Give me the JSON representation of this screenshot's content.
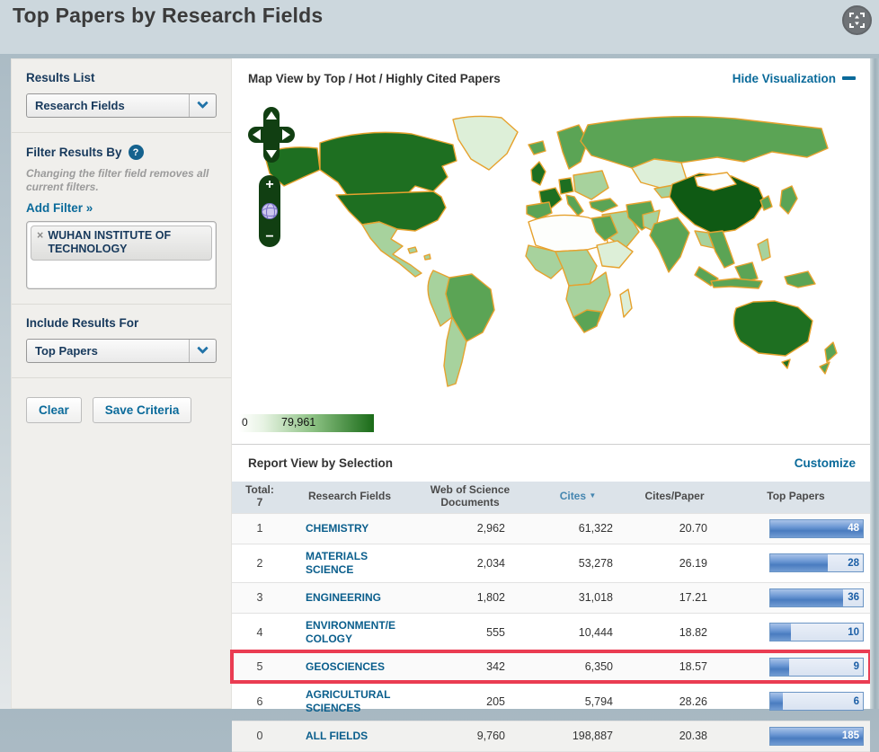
{
  "page": {
    "title": "Top Papers by Research Fields"
  },
  "colors": {
    "accent_blue": "#0a6a9a",
    "navy_heading": "#17395c",
    "map_border_orange": "#e6a22e",
    "map_scale_low": "#ffffff",
    "map_scale_high": "#1a6b18",
    "bar_blue": "#4a7cc0",
    "highlight_red": "#ea3c52",
    "header_bg": "#ccd7dd"
  },
  "sidebar": {
    "results_list": {
      "label": "Results List",
      "value": "Research Fields"
    },
    "filter": {
      "label": "Filter Results By",
      "help": "?",
      "note": "Changing the filter field removes all current filters.",
      "add_filter": "Add Filter »",
      "chip": {
        "remove": "×",
        "label": "WUHAN INSTITUTE OF TECHNOLOGY"
      }
    },
    "include": {
      "label": "Include Results For",
      "value": "Top Papers"
    },
    "buttons": {
      "clear": "Clear",
      "save": "Save Criteria"
    }
  },
  "map": {
    "title": "Map View by Top / Hot / Highly Cited Papers",
    "hide_link": "Hide Visualization",
    "legend": {
      "min": "0",
      "max": "79,961"
    },
    "controls": {
      "zoom_in": "+",
      "zoom_out": "−"
    }
  },
  "report": {
    "title": "Report View by Selection",
    "customize": "Customize",
    "table": {
      "headers": {
        "total_line1": "Total:",
        "total_line2": "7",
        "field": "Research Fields",
        "documents": "Web of Science Documents",
        "cites": "Cites",
        "sort_indicator": "▼",
        "cites_per_paper": "Cites/Paper",
        "top_papers": "Top Papers"
      },
      "rows": [
        {
          "rank": "1",
          "field": "CHEMISTRY",
          "documents": "2,962",
          "cites": "61,322",
          "cites_per_paper": "20.70",
          "top_papers": "48",
          "bar_pct": 100
        },
        {
          "rank": "2",
          "field": "MATERIALS SCIENCE",
          "documents": "2,034",
          "cites": "53,278",
          "cites_per_paper": "26.19",
          "top_papers": "28",
          "bar_pct": 62
        },
        {
          "rank": "3",
          "field": "ENGINEERING",
          "documents": "1,802",
          "cites": "31,018",
          "cites_per_paper": "17.21",
          "top_papers": "36",
          "bar_pct": 79
        },
        {
          "rank": "4",
          "field": "ENVIRONMENT/ECOLOGY",
          "documents": "555",
          "cites": "10,444",
          "cites_per_paper": "18.82",
          "top_papers": "10",
          "bar_pct": 22
        },
        {
          "rank": "5",
          "field": "GEOSCIENCES",
          "documents": "342",
          "cites": "6,350",
          "cites_per_paper": "18.57",
          "top_papers": "9",
          "bar_pct": 20,
          "highlighted": true
        },
        {
          "rank": "6",
          "field": "AGRICULTURAL SCIENCES",
          "documents": "205",
          "cites": "5,794",
          "cites_per_paper": "28.26",
          "top_papers": "6",
          "bar_pct": 14
        },
        {
          "rank": "0",
          "field": "ALL FIELDS",
          "documents": "9,760",
          "cites": "198,887",
          "cites_per_paper": "20.38",
          "top_papers": "185",
          "bar_pct": 100,
          "is_total": true
        }
      ]
    }
  }
}
